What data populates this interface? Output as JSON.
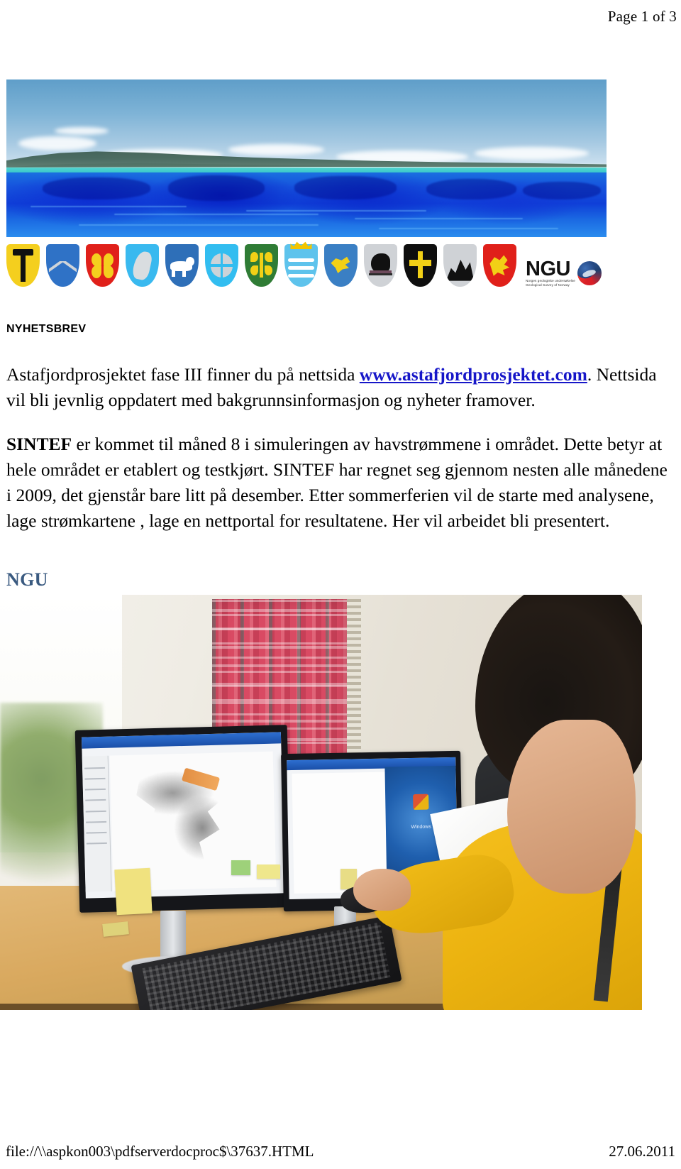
{
  "header": {
    "page_indicator": "Page 1 of 3"
  },
  "banner": {
    "alt": "Bathymetry visualisation of Astafjord seabed with sky and coastal hills"
  },
  "crests": {
    "alt": "Row of municipal coats of arms of participating municipalities",
    "items": [
      {
        "name": "crest-torsken",
        "field": "#f4cf1e",
        "charge": "#111111"
      },
      {
        "name": "crest-chevron",
        "field": "#2f72c6",
        "charge": "#cfd4d9"
      },
      {
        "name": "crest-red-quatrefoil",
        "field": "#e0201a",
        "charge": "#f4cf1e"
      },
      {
        "name": "crest-seal",
        "field": "#39b9ef",
        "charge": "#d9dde0"
      },
      {
        "name": "crest-otter",
        "field": "#2e6fb8",
        "charge": "#ffffff"
      },
      {
        "name": "crest-pinwheel",
        "field": "#32bdf0",
        "charge": "#ccd3d8"
      },
      {
        "name": "crest-green-flowers",
        "field": "#2f7c35",
        "charge": "#f2d016"
      },
      {
        "name": "crest-crown-waves",
        "field": "#5ec3ec",
        "charge": "#f2c400"
      },
      {
        "name": "crest-griffin",
        "field": "#3a7fc4",
        "charge": "#f2d016"
      },
      {
        "name": "crest-black-bird",
        "field": "#cfd2d6",
        "charge": "#111111"
      },
      {
        "name": "crest-cross",
        "field": "#0e0e0e",
        "charge": "#f2d016"
      },
      {
        "name": "crest-mountain",
        "field": "#cfd2d6",
        "charge": "#111111"
      },
      {
        "name": "crest-lion",
        "field": "#e0201a",
        "charge": "#f2d016"
      }
    ]
  },
  "ngu_logo": {
    "wordmark": "NGU",
    "subtitle_line1": "Norges geologiske undersøkelse",
    "subtitle_line2": "Geological Survey of Norway"
  },
  "content": {
    "newsletter_label": "NYHETSBREV",
    "para1_before_link": "Astafjordprosjektet fase III finner du på nettsida ",
    "link_text": "www.astafjordprosjektet.com",
    "para1_after_link": ". Nettsida vil bli jevnlig oppdatert med bakgrunnsinformasjon og nyheter framover.",
    "para2_bold": "SINTEF",
    "para2_rest": " er kommet til måned 8 i simuleringen av havstrømmene i området. Dette betyr at hele området er etablert og testkjørt. SINTEF har regnet seg gjennom nesten alle månedene i 2009, det gjenstår bare litt på desember. Etter sommerferien vil de starte med analysene, lage strømkartene , lage en nettportal for resultatene. Her vil arbeidet bli presentert.",
    "ngu_caption": "NGU"
  },
  "photo": {
    "alt": "Woman in yellow jacket working at dual Dell monitors running GIS software, keyboard and desk with post-it notes",
    "screen2_windows_label": "Windows"
  },
  "footer": {
    "file_path": "file://\\\\aspkon003\\pdfserverdocproc$\\37637.HTML",
    "date": "27.06.2011"
  },
  "colors": {
    "link": "#1616c8",
    "ngu_caption": "#3a5a80",
    "sea_deep": "#0f3fd8",
    "sea_shallow": "#2a8cee"
  }
}
